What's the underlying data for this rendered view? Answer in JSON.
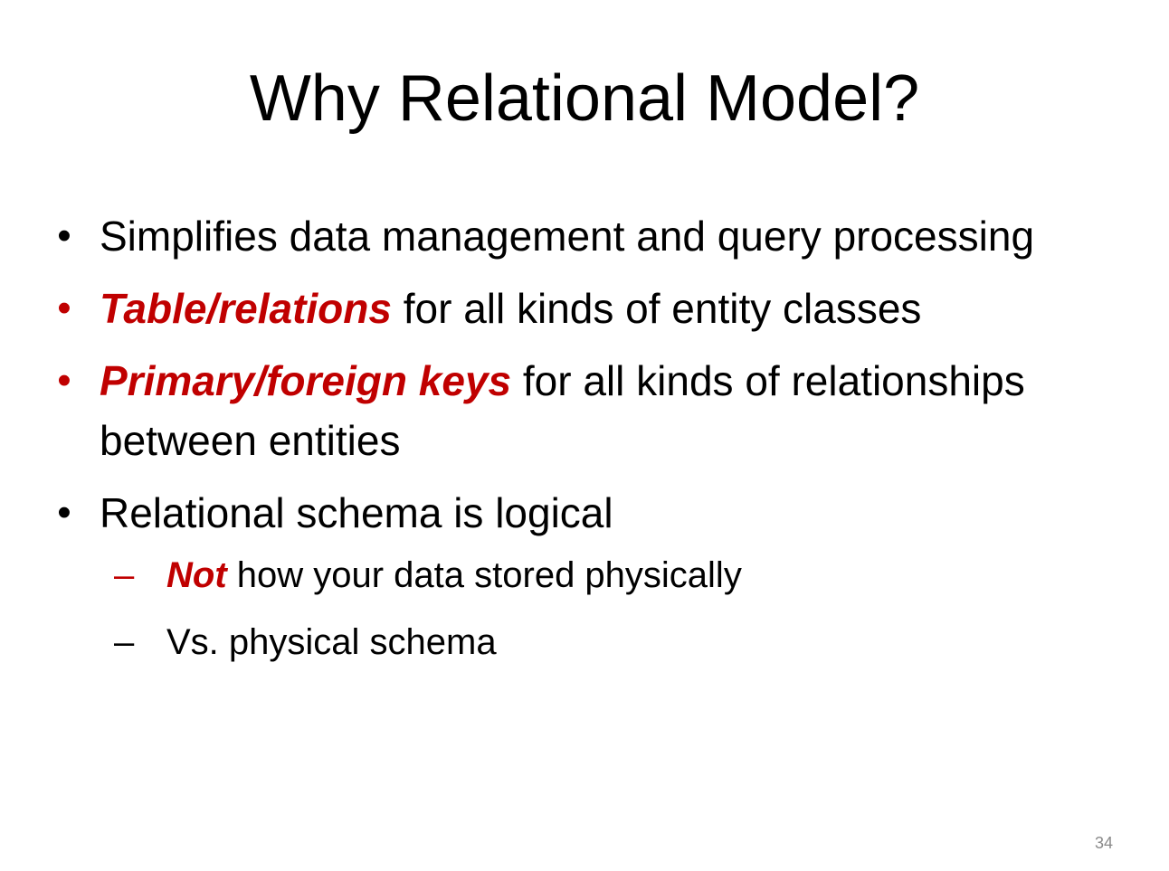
{
  "slide": {
    "title": "Why Relational Model?",
    "bullets": [
      {
        "emphasis": "",
        "text": "Simplifies data management and query processing"
      },
      {
        "emphasis": "Table/relations",
        "text": " for all kinds of entity classes"
      },
      {
        "emphasis": "Primary/foreign keys",
        "text": " for all kinds of relationships between entities"
      },
      {
        "emphasis": "",
        "text": "Relational schema is logical",
        "sub": [
          {
            "emphasis": "Not",
            "text": " how your data stored physically"
          },
          {
            "emphasis": "",
            "text": "Vs. physical schema"
          }
        ]
      }
    ],
    "bullet_glyph": "•",
    "sub_glyph": "–",
    "page_number": "34"
  },
  "colors": {
    "accent": "#c00000",
    "text": "#000000",
    "page_number": "#8a8a8a"
  }
}
